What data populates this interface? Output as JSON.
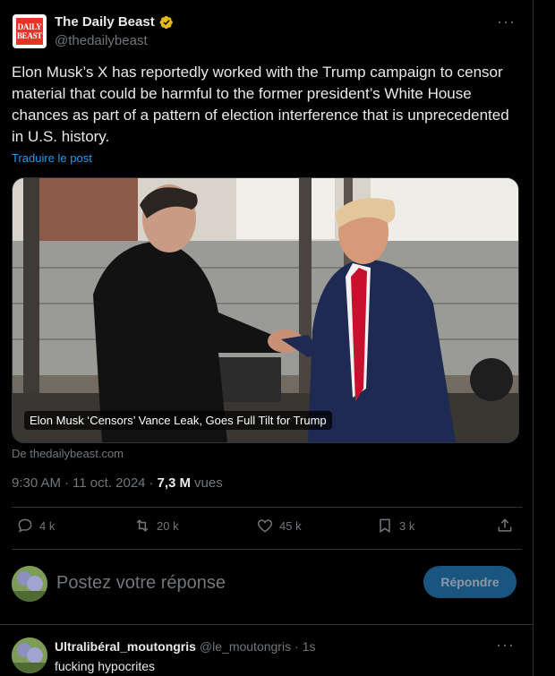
{
  "tweet": {
    "account": {
      "display_name": "The Daily Beast",
      "handle": "@thedailybeast",
      "logo_text_1": "DAILY",
      "logo_text_2": "BEAST",
      "verified_color": "#e2b719"
    },
    "more_label": "···",
    "text": "Elon Musk’s X has reportedly worked with the Trump campaign to censor material that could be harmful to the former president’s White House chances as part of a pattern of election interference that is unprecedented in U.S. history.",
    "translate_label": "Traduire le post",
    "media": {
      "caption": "Elon Musk ‘Censors’ Vance Leak, Goes Full Tilt for Trump",
      "source": "De thedailybeast.com"
    },
    "meta": {
      "time": "9:30 AM",
      "sep1": "·",
      "date": "11 oct. 2024",
      "sep2": "·",
      "views_count": "7,3 M",
      "views_label": "vues"
    },
    "actions": {
      "replies": "4 k",
      "reposts": "20 k",
      "likes": "45 k",
      "bookmarks": "3 k"
    }
  },
  "composer": {
    "placeholder": "Postez votre réponse",
    "button_label": "Répondre"
  },
  "replies": [
    {
      "display_name": "Ultralibéral_moutongris",
      "handle": "@le_moutongris",
      "sep": "·",
      "time": "1s",
      "text": "fucking hypocrites"
    }
  ],
  "colors": {
    "accent": "#1d9bf0",
    "muted": "#71767b",
    "border": "#2f3336"
  }
}
